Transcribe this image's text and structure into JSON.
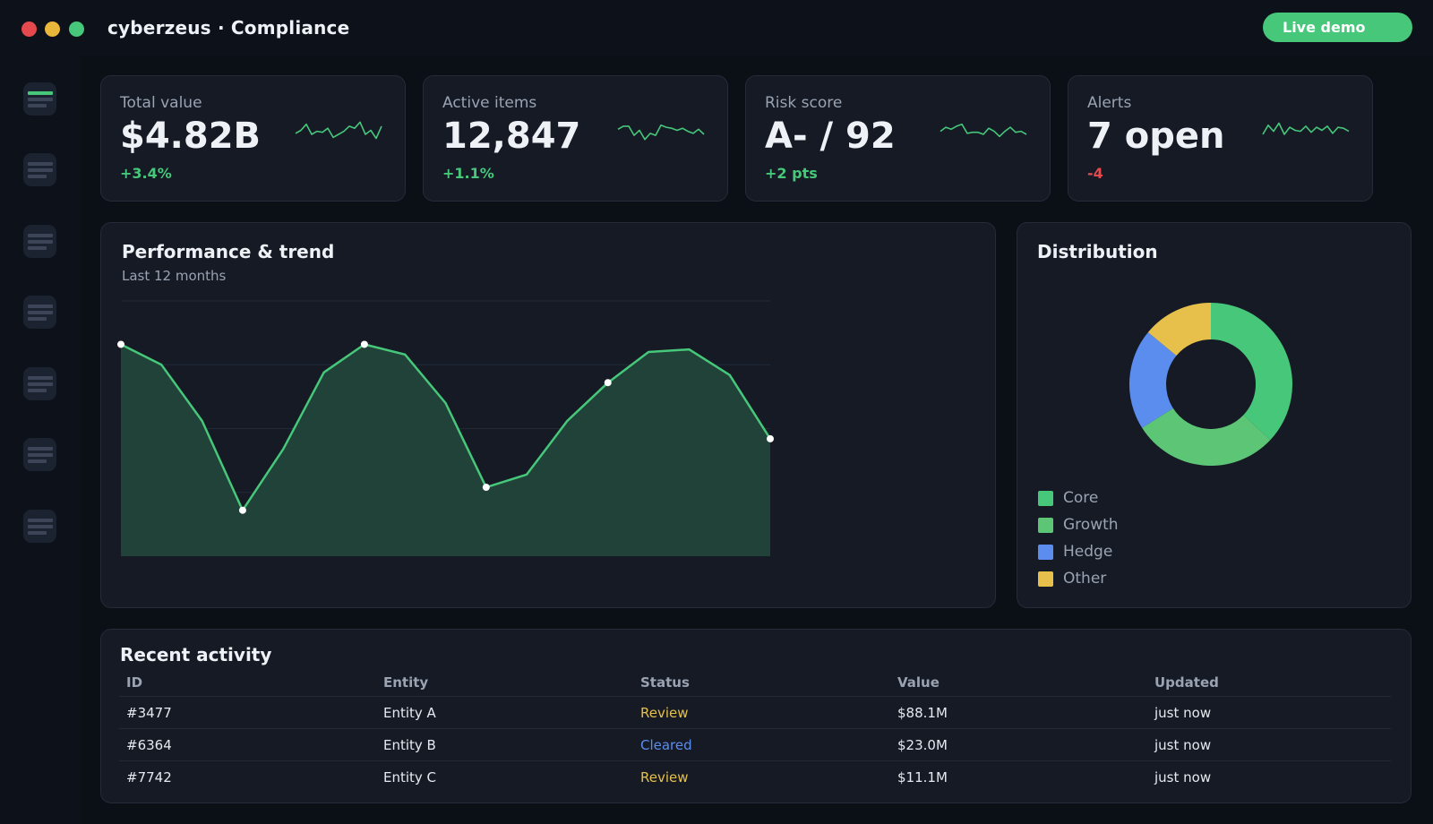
{
  "window": {
    "title": "cyberzeus · Compliance",
    "live_button": "Live demo"
  },
  "sidebar": {
    "items": [
      {
        "icon": "menu-icon",
        "active": true
      },
      {
        "icon": "menu-icon",
        "active": false
      },
      {
        "icon": "menu-icon",
        "active": false
      },
      {
        "icon": "menu-icon",
        "active": false
      },
      {
        "icon": "menu-icon",
        "active": false
      },
      {
        "icon": "menu-icon",
        "active": false
      },
      {
        "icon": "menu-icon",
        "active": false
      }
    ]
  },
  "kpis": [
    {
      "label": "Total value",
      "value": "$4.82B",
      "delta": "+3.4%",
      "trend": "positive",
      "spark": [
        32,
        38,
        50,
        30,
        36,
        34,
        42,
        24,
        30,
        36,
        46,
        42,
        54,
        30,
        38,
        22,
        46
      ]
    },
    {
      "label": "Active items",
      "value": "12,847",
      "delta": "+1.1%",
      "trend": "positive",
      "spark": [
        40,
        46,
        46,
        28,
        38,
        20,
        32,
        28,
        48,
        44,
        42,
        38,
        42,
        36,
        32,
        40,
        30
      ]
    },
    {
      "label": "Risk score",
      "value": "A- / 92",
      "delta": "+2 pts",
      "trend": "positive",
      "spark": [
        36,
        44,
        40,
        46,
        50,
        32,
        34,
        34,
        30,
        42,
        36,
        26,
        36,
        44,
        34,
        36,
        30
      ]
    },
    {
      "label": "Alerts",
      "value": "7 open",
      "delta": "-4",
      "trend": "negative",
      "spark": [
        30,
        48,
        36,
        52,
        30,
        44,
        38,
        36,
        46,
        34,
        44,
        38,
        46,
        32,
        44,
        42,
        36
      ]
    }
  ],
  "performance": {
    "title": "Performance & trend",
    "subtitle": "Last 12 months"
  },
  "chart_data": {
    "type": "area",
    "title": "Performance & trend",
    "subtitle": "Last 12 months",
    "values": [
      83,
      75,
      53,
      18,
      42,
      72,
      83,
      79,
      60,
      27,
      32,
      53,
      68,
      80,
      81,
      71,
      46
    ],
    "markers": [
      0,
      3,
      6,
      9,
      12,
      16
    ],
    "ylim": [
      0,
      100
    ],
    "grid": true,
    "line_color": "#46c77a",
    "fill_color": "#204238"
  },
  "distribution": {
    "title": "Distribution",
    "segments": [
      {
        "name": "Core",
        "value": 37,
        "color": "#46c77a"
      },
      {
        "name": "Growth",
        "value": 29,
        "color": "#5cc676"
      },
      {
        "name": "Hedge",
        "value": 20,
        "color": "#5b8def"
      },
      {
        "name": "Other",
        "value": 14,
        "color": "#e6c04a"
      }
    ]
  },
  "activity": {
    "title": "Recent activity",
    "columns": [
      "ID",
      "Entity",
      "Status",
      "Value",
      "Updated"
    ],
    "rows": [
      {
        "id": "#3477",
        "entity": "Entity A",
        "status": "Review",
        "status_color": "#e6c04a",
        "value": "$88.1M",
        "updated": "just now"
      },
      {
        "id": "#6364",
        "entity": "Entity B",
        "status": "Cleared",
        "status_color": "#5b8def",
        "value": "$23.0M",
        "updated": "just now"
      },
      {
        "id": "#7742",
        "entity": "Entity C",
        "status": "Review",
        "status_color": "#e6c04a",
        "value": "$11.1M",
        "updated": "just now"
      }
    ]
  }
}
